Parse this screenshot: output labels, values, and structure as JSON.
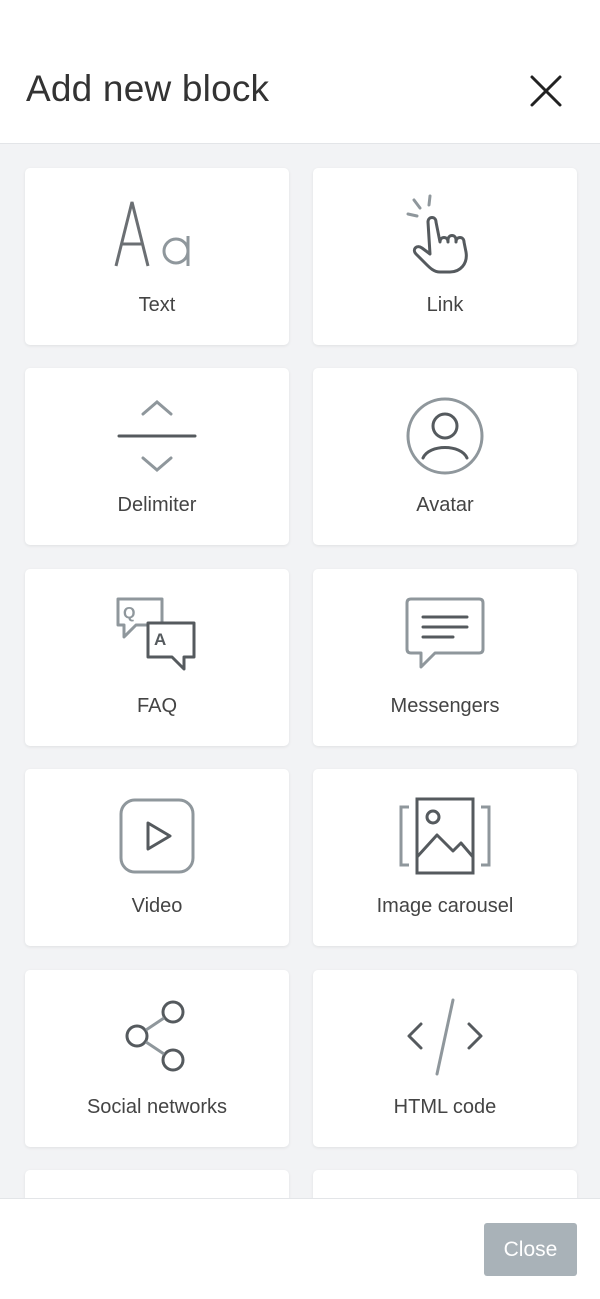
{
  "header": {
    "title": "Add new block",
    "close_icon": "close-icon"
  },
  "blocks": [
    {
      "label": "Text",
      "icon": "text-aa-icon"
    },
    {
      "label": "Link",
      "icon": "tap-hand-icon"
    },
    {
      "label": "Delimiter",
      "icon": "delimiter-icon"
    },
    {
      "label": "Avatar",
      "icon": "avatar-icon"
    },
    {
      "label": "FAQ",
      "icon": "faq-bubbles-icon"
    },
    {
      "label": "Messengers",
      "icon": "message-bubble-icon"
    },
    {
      "label": "Video",
      "icon": "play-icon"
    },
    {
      "label": "Image carousel",
      "icon": "image-carousel-icon"
    },
    {
      "label": "Social networks",
      "icon": "share-icon"
    },
    {
      "label": "HTML code",
      "icon": "code-icon"
    },
    {
      "label": "",
      "icon": ""
    },
    {
      "label": "",
      "icon": ""
    }
  ],
  "footer": {
    "close_label": "Close"
  },
  "colors": {
    "icon_gray": "#6b6f73",
    "icon_light": "#8f979c",
    "button_bg": "#a9b2b8"
  }
}
